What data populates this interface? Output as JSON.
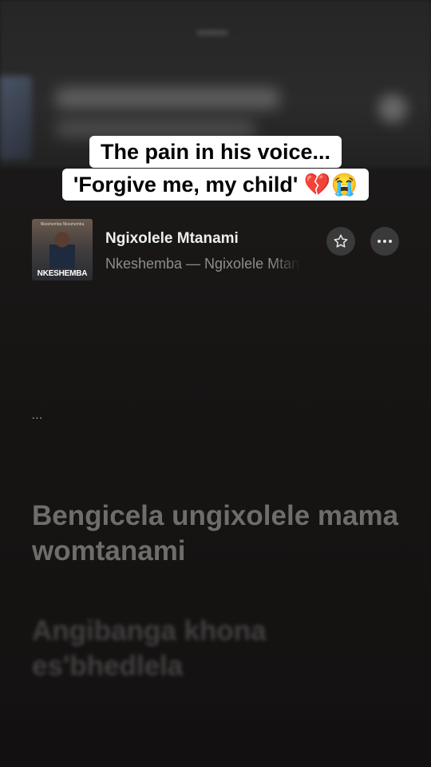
{
  "overlay_caption": {
    "line1": "The pain in his voice...",
    "line2": "'Forgive me, my child' 💔😭"
  },
  "now_playing": {
    "album_art": {
      "artist_label": "NKESHEMBA",
      "top_text": "Nkeshemba Nkeshemba"
    },
    "title": "Ngixolele Mtanami",
    "subtitle": "Nkeshemba — Ngixolele Mtanami",
    "star_icon": "star-outline-icon",
    "more_icon": "ellipsis-icon"
  },
  "lyrics": {
    "interlude": "...",
    "current": "Bengicela ungixolele mama womtanami",
    "next": "Angibanga khona es'bhedlela"
  },
  "colors": {
    "background": "#151313",
    "caption_bg": "#ffffff",
    "title": "#eeeeee",
    "subtitle": "#8d8d8d",
    "lyric_current": "#6f6c6b"
  }
}
